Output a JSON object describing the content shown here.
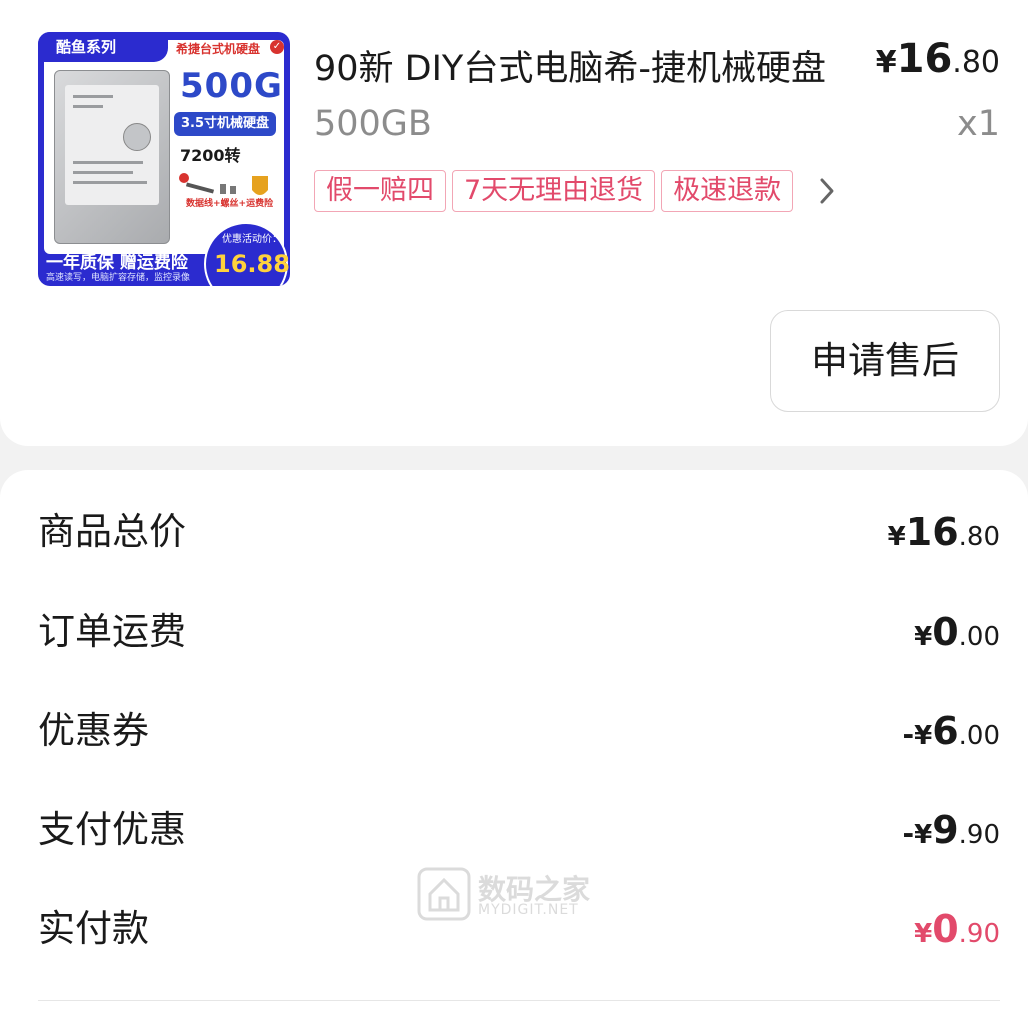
{
  "product": {
    "thumbnail": {
      "series": "酷鱼系列",
      "brand_line": "希捷台式机硬盘",
      "capacity": "500G",
      "size": "3.5寸机械硬盘",
      "rpm": "7200转",
      "accessories": "数据线+螺丝+运费险",
      "warranty": "一年质保 赠运费险",
      "subnote": "高速读写，电脑扩容存储，监控录像",
      "promo_label": "优惠活动价：",
      "promo_price": "16.88"
    },
    "title": "90新  DIY台式电脑希-捷机械硬盘",
    "price_symbol": "¥",
    "price_int": "16",
    "price_dec": ".80",
    "spec": "500GB",
    "quantity": "x1",
    "tags": [
      "假一赔四",
      "7天无理由退货",
      "极速退款"
    ],
    "after_sale_button": "申请售后"
  },
  "summary": {
    "rows": [
      {
        "label": "商品总价",
        "sign": "",
        "symbol": "¥",
        "int": "16",
        "dec": ".80"
      },
      {
        "label": "订单运费",
        "sign": "",
        "symbol": "¥",
        "int": "0",
        "dec": ".00"
      },
      {
        "label": "优惠券",
        "sign": "-",
        "symbol": "¥",
        "int": "6",
        "dec": ".00"
      },
      {
        "label": "支付优惠",
        "sign": "-",
        "symbol": "¥",
        "int": "9",
        "dec": ".90"
      },
      {
        "label": "实付款",
        "sign": "",
        "symbol": "¥",
        "int": "0",
        "dec": ".90"
      }
    ]
  },
  "watermark": {
    "zh": "数码之家",
    "en": "MYDIGIT.NET"
  },
  "colors": {
    "accent_pink": "#e24a6b",
    "tag_border": "#f2a6b5",
    "thumb_blue": "#2b2bcf"
  },
  "icons": {
    "tags_more": "chevron-right-icon"
  }
}
